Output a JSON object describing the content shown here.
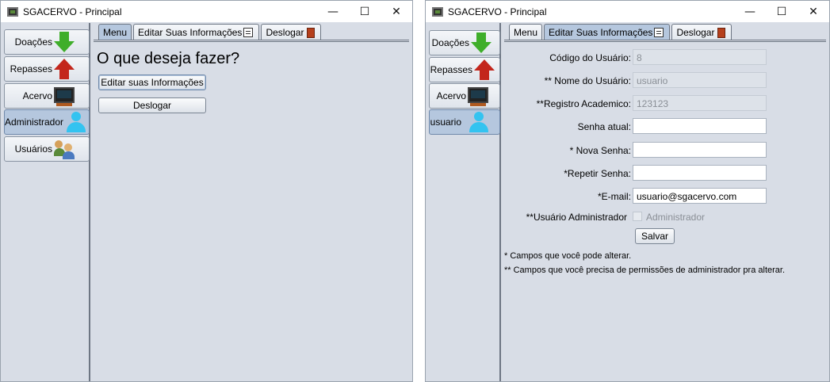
{
  "window1": {
    "title": "SGACERVO - Principal",
    "controls": {
      "minimize": "—",
      "maximize": "☐",
      "close": "✕"
    },
    "sidebar": [
      {
        "label": "Doações",
        "icon": "green-down-arrow-icon"
      },
      {
        "label": "Repasses",
        "icon": "red-up-arrow-icon"
      },
      {
        "label": "Acervo",
        "icon": "monitor-icon"
      },
      {
        "label": "Administrador",
        "icon": "user-icon"
      },
      {
        "label": "Usuários",
        "icon": "users-icon"
      }
    ],
    "tabs": [
      "Menu",
      "Editar Suas Informações",
      "Deslogar"
    ],
    "heading": "O que deseja fazer?",
    "buttons": {
      "edit": "Editar suas Informações",
      "logout": "Deslogar"
    }
  },
  "window2": {
    "title": "SGACERVO - Principal",
    "controls": {
      "minimize": "—",
      "maximize": "☐",
      "close": "✕"
    },
    "sidebar": [
      {
        "label": "Doações",
        "icon": "green-down-arrow-icon"
      },
      {
        "label": "Repasses",
        "icon": "red-up-arrow-icon"
      },
      {
        "label": "Acervo",
        "icon": "monitor-icon"
      },
      {
        "label": "usuario",
        "icon": "user-icon"
      }
    ],
    "tabs": [
      "Menu",
      "Editar Suas Informações",
      "Deslogar"
    ],
    "form": {
      "codigo": {
        "label": "Código do Usuário:",
        "value": "8"
      },
      "nome": {
        "label": "** Nome do Usuário:",
        "value": "usuario"
      },
      "registro": {
        "label": "**Registro Academico:",
        "value": "123123"
      },
      "senha_atual": {
        "label": "Senha atual:",
        "value": ""
      },
      "nova_senha": {
        "label": "* Nova Senha:",
        "value": ""
      },
      "repetir_senha": {
        "label": "*Repetir Senha:",
        "value": ""
      },
      "email": {
        "label": "*E-mail:",
        "value": "usuario@sgacervo.com"
      },
      "admin": {
        "label": "**Usuário Administrador",
        "checkbox_label": "Administrador",
        "checked": false
      },
      "save": "Salvar"
    },
    "hints": [
      "* Campos que você pode alterar.",
      "** Campos que você precisa de permissões de administrador pra alterar."
    ]
  }
}
